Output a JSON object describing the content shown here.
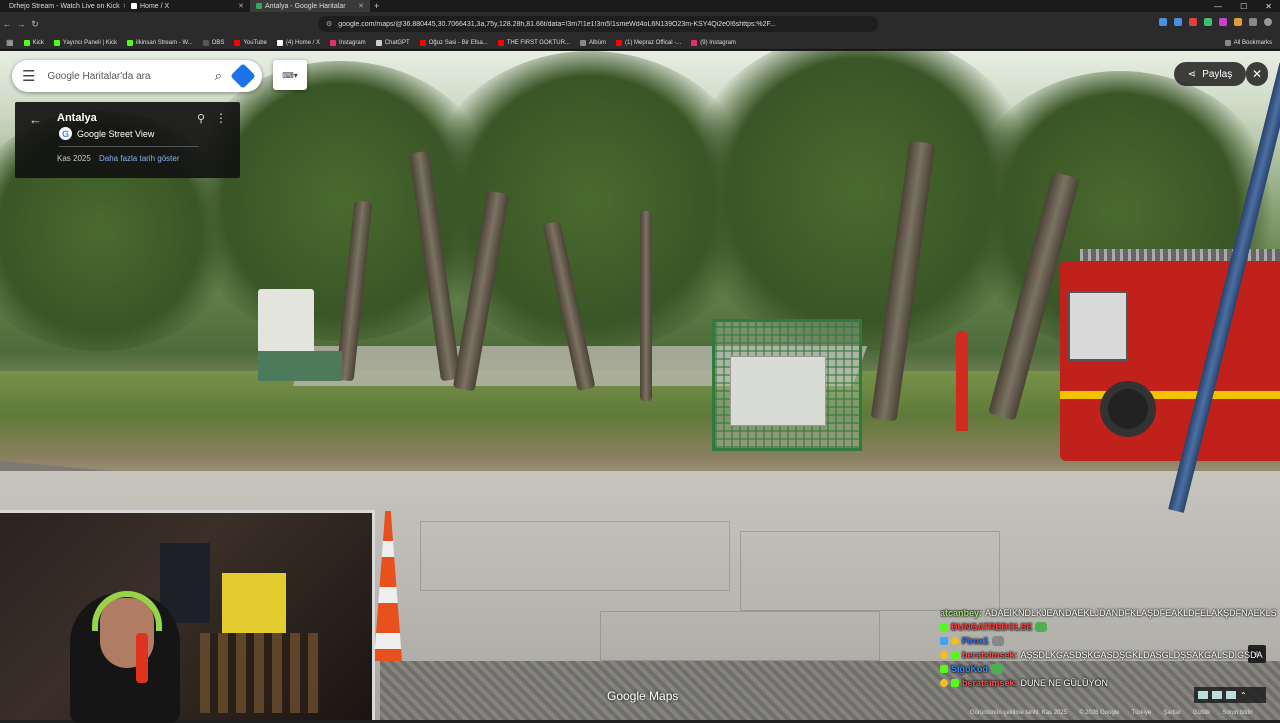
{
  "browser": {
    "tabs": [
      {
        "label": "Drhejo Stream - Watch Live on Kick",
        "icon_color": "#53fc18"
      },
      {
        "label": "Home / X",
        "icon_color": "#ffffff"
      },
      {
        "label": "Antalya - Google Haritalar",
        "icon_color": "#34a853",
        "active": true
      }
    ],
    "url": "google.com/maps/@36.880445,30.7066431,3a,75y,128.28h,81.66t/data=!3m7!1e1!3m5!1smeWd4oL6N139O23m-KSY4Qi2e0!6shttps:%2F..."
  },
  "bookmarks": [
    {
      "label": "Kick",
      "color": "#53fc18"
    },
    {
      "label": "Yayıncı Paneli | Kick",
      "color": "#53fc18"
    },
    {
      "label": "ilkinsan Stream - W...",
      "color": "#53fc18"
    },
    {
      "label": "OBS",
      "color": "#555555"
    },
    {
      "label": "YouTube",
      "color": "#ff0000"
    },
    {
      "label": "(4) Home / X",
      "color": "#ffffff"
    },
    {
      "label": "Instagram",
      "color": "#e1306c"
    },
    {
      "label": "ChatGPT",
      "color": "#cccccc"
    },
    {
      "label": "Oğuz Sasi - Bir Efsa...",
      "color": "#ff0000"
    },
    {
      "label": "THE FIRST GOKTUR...",
      "color": "#ff0000"
    },
    {
      "label": "Albüm",
      "color": "#888888"
    },
    {
      "label": "(1) Mepraz Offical -...",
      "color": "#ff0000"
    },
    {
      "label": "(9) Instagram",
      "color": "#e1306c"
    }
  ],
  "bookmarks_all": "All Bookmarks",
  "maps": {
    "search_placeholder": "Google Haritalar'da ara",
    "place_title": "Antalya",
    "source": "Google Street View",
    "date": "Kas 2025",
    "more_dates": "Daha fazla tarih göster",
    "share": "Paylaş",
    "brand": "Google Maps",
    "footer": [
      "Görüntünün çekilme tarihi: Kas 2025",
      "© 2026 Google",
      "Türkiye",
      "Şartlar",
      "Gizlilik",
      "Sorun bildir"
    ],
    "accent": "#1a73e8"
  },
  "chat": [
    {
      "user": "atcanbey:",
      "color": "#9be564",
      "msg": "ADAEIKNDLKJEANDAEKLJDANDFKLAŞDFEAKLDFELAKŞDFNAEKLS"
    },
    {
      "user": "DUNGATREDOLSE",
      "color": "#ff3b3b",
      "msg": ""
    },
    {
      "user": "Firex1",
      "color": "#2f6cff",
      "msg": ""
    },
    {
      "user": "beratsimsek:",
      "color": "#ff4a4a",
      "msg": "AŞSDLKGASDŞKGASDŞGKLDASGLDŞSAKGALSDIGSDA"
    },
    {
      "user": "SiğoKod",
      "color": "#2f8cff",
      "msg": ""
    },
    {
      "user": "beratsimsek:",
      "color": "#ff4a4a",
      "msg": "DUNE NE GÜLÜYON"
    }
  ]
}
